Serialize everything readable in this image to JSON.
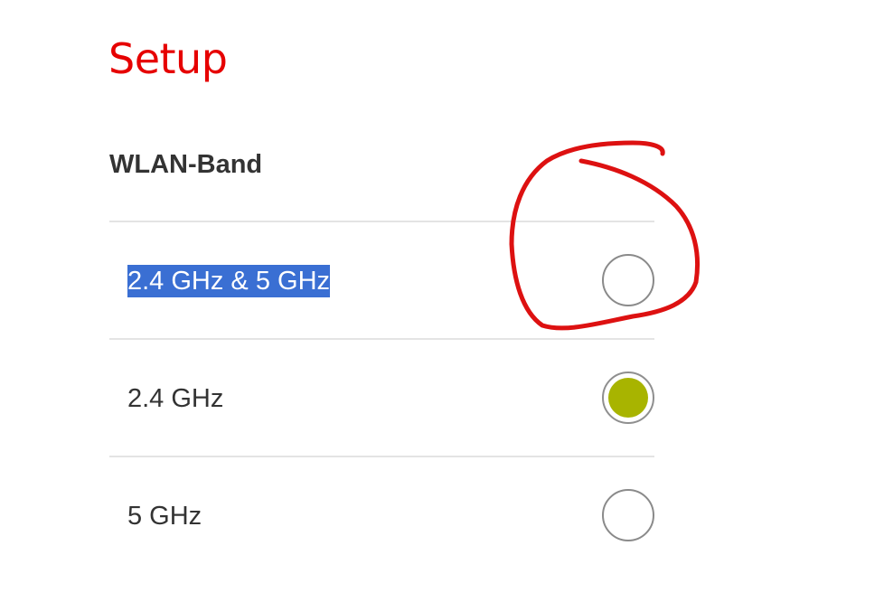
{
  "header": {
    "title": "Setup"
  },
  "wlan_band": {
    "heading": "WLAN-Band",
    "options": [
      {
        "label": "2.4 GHz & 5 GHz",
        "checked": false,
        "text_highlighted": true
      },
      {
        "label": "2.4 GHz",
        "checked": true,
        "text_highlighted": false
      },
      {
        "label": "5 GHz",
        "checked": false,
        "text_highlighted": false
      }
    ]
  },
  "colors": {
    "title": "#e60000",
    "radio_checked_fill": "#a8b400",
    "text_selection": "#3a6fd3",
    "annotation_stroke": "#dd1111"
  }
}
